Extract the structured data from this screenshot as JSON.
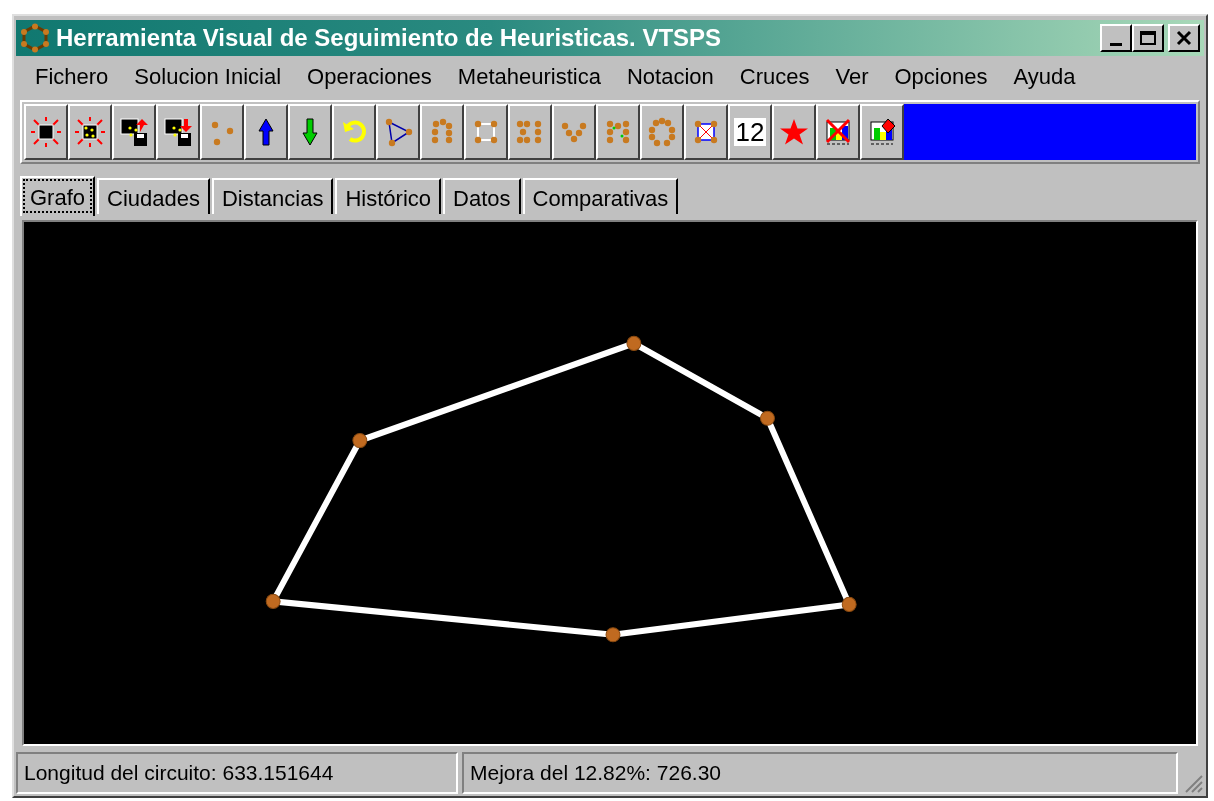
{
  "window": {
    "title": "Herramienta Visual de Seguimiento de Heuristicas. VTSPS"
  },
  "menu": [
    "Fichero",
    "Solucion Inicial",
    "Operaciones",
    "Metaheuristica",
    "Notacion",
    "Cruces",
    "Ver",
    "Opciones",
    "Ayuda"
  ],
  "toolbar": {
    "number_button": "12"
  },
  "tabs": [
    {
      "label": "Grafo",
      "selected": true
    },
    {
      "label": "Ciudades",
      "selected": false
    },
    {
      "label": "Distancias",
      "selected": false
    },
    {
      "label": "Histórico",
      "selected": false
    },
    {
      "label": "Datos",
      "selected": false
    },
    {
      "label": "Comparativas",
      "selected": false
    }
  ],
  "status_bar": [
    "Longitud del circuito: 633.151644",
    "Mejora del 12.82%: 726.30"
  ]
}
